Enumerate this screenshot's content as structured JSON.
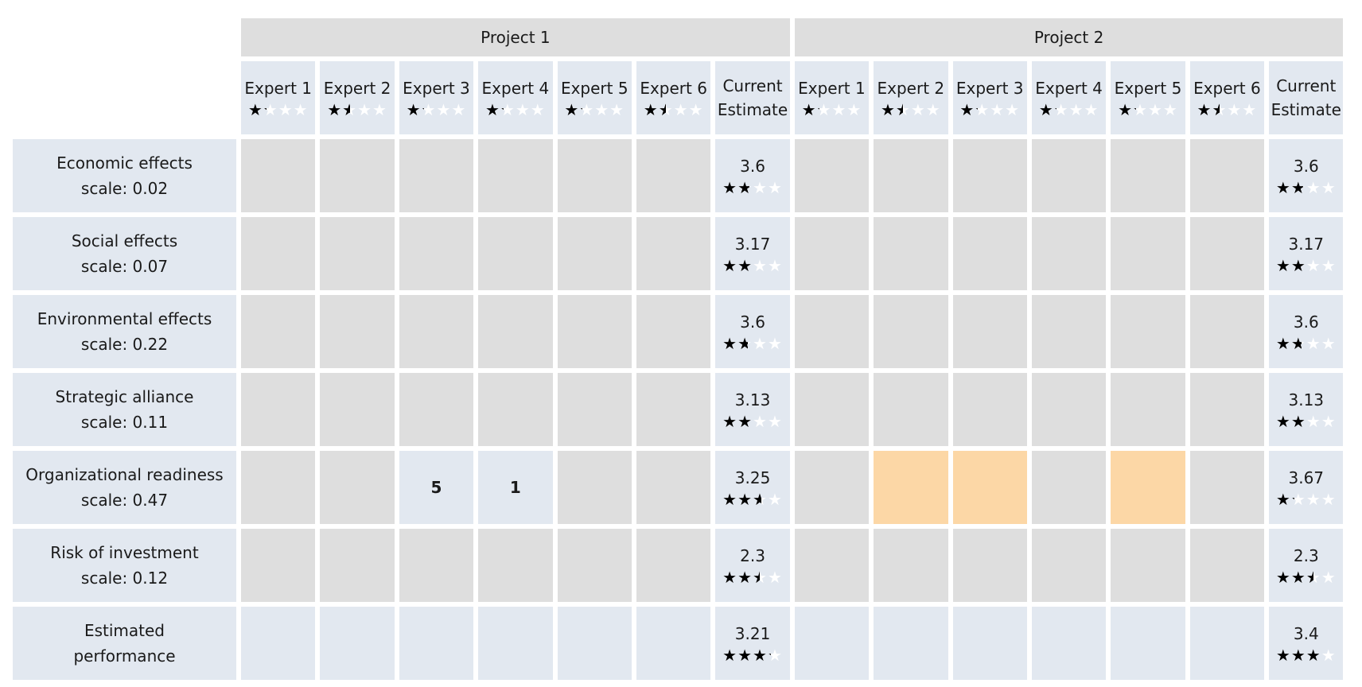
{
  "projects": [
    {
      "name": "Project 1",
      "experts": [
        {
          "label": "Expert 1",
          "rating": 1.2
        },
        {
          "label": "Expert 2",
          "rating": 1.5
        },
        {
          "label": "Expert 3",
          "rating": 1.2
        },
        {
          "label": "Expert 4",
          "rating": 1.2
        },
        {
          "label": "Expert 5",
          "rating": 1.2
        },
        {
          "label": "Expert 6",
          "rating": 1.5
        }
      ],
      "estimate_label_1": "Current",
      "estimate_label_2": "Estimate"
    },
    {
      "name": "Project 2",
      "experts": [
        {
          "label": "Expert 1",
          "rating": 1.2
        },
        {
          "label": "Expert 2",
          "rating": 1.5
        },
        {
          "label": "Expert 3",
          "rating": 1.2
        },
        {
          "label": "Expert 4",
          "rating": 1.2
        },
        {
          "label": "Expert 5",
          "rating": 1.2
        },
        {
          "label": "Expert 6",
          "rating": 1.5
        }
      ],
      "estimate_label_1": "Current",
      "estimate_label_2": "Estimate"
    }
  ],
  "max_stars": 4,
  "star_glyph": "★",
  "colors": {
    "empty": "#dedede",
    "filled": "#e2e8f0",
    "highlight": "#fcd7a6"
  },
  "rows": [
    {
      "name": "Economic effects",
      "scale": "scale: 0.02",
      "p1": {
        "cells": [
          "",
          "",
          "",
          "",
          "",
          ""
        ],
        "states": [
          "empty",
          "empty",
          "empty",
          "empty",
          "empty",
          "empty"
        ],
        "estimate": "3.6",
        "stars": 1.8
      },
      "p2": {
        "cells": [
          "",
          "",
          "",
          "",
          "",
          ""
        ],
        "states": [
          "empty",
          "empty",
          "empty",
          "empty",
          "empty",
          "empty"
        ],
        "estimate": "3.6",
        "stars": 1.8
      }
    },
    {
      "name": "Social effects",
      "scale": "scale: 0.07",
      "p1": {
        "cells": [
          "",
          "",
          "",
          "",
          "",
          ""
        ],
        "states": [
          "empty",
          "empty",
          "empty",
          "empty",
          "empty",
          "empty"
        ],
        "estimate": "3.17",
        "stars": 2.0
      },
      "p2": {
        "cells": [
          "",
          "",
          "",
          "",
          "",
          ""
        ],
        "states": [
          "empty",
          "empty",
          "empty",
          "empty",
          "empty",
          "empty"
        ],
        "estimate": "3.17",
        "stars": 2.0
      }
    },
    {
      "name": "Environmental effects",
      "scale": "scale: 0.22",
      "p1": {
        "cells": [
          "",
          "",
          "",
          "",
          "",
          ""
        ],
        "states": [
          "empty",
          "empty",
          "empty",
          "empty",
          "empty",
          "empty"
        ],
        "estimate": "3.6",
        "stars": 1.7
      },
      "p2": {
        "cells": [
          "",
          "",
          "",
          "",
          "",
          ""
        ],
        "states": [
          "empty",
          "empty",
          "empty",
          "empty",
          "empty",
          "empty"
        ],
        "estimate": "3.6",
        "stars": 1.7
      }
    },
    {
      "name": "Strategic alliance",
      "scale": "scale: 0.11",
      "p1": {
        "cells": [
          "",
          "",
          "",
          "",
          "",
          ""
        ],
        "states": [
          "empty",
          "empty",
          "empty",
          "empty",
          "empty",
          "empty"
        ],
        "estimate": "3.13",
        "stars": 2.0
      },
      "p2": {
        "cells": [
          "",
          "",
          "",
          "",
          "",
          ""
        ],
        "states": [
          "empty",
          "empty",
          "empty",
          "empty",
          "empty",
          "empty"
        ],
        "estimate": "3.13",
        "stars": 2.0
      }
    },
    {
      "name": "Organizational readiness",
      "scale": "scale: 0.47",
      "p1": {
        "cells": [
          "",
          "",
          "5",
          "1",
          "",
          ""
        ],
        "states": [
          "empty",
          "empty",
          "filled",
          "filled",
          "empty",
          "empty"
        ],
        "estimate": "3.25",
        "stars": 2.6
      },
      "p2": {
        "cells": [
          "",
          "",
          "",
          "",
          "",
          ""
        ],
        "states": [
          "empty",
          "highlight",
          "highlight",
          "empty",
          "highlight",
          "empty"
        ],
        "estimate": "3.67",
        "stars": 1.2
      }
    },
    {
      "name": "Risk of investment",
      "scale": "scale: 0.12",
      "p1": {
        "cells": [
          "",
          "",
          "",
          "",
          "",
          ""
        ],
        "states": [
          "empty",
          "empty",
          "empty",
          "empty",
          "empty",
          "empty"
        ],
        "estimate": "2.3",
        "stars": 2.5
      },
      "p2": {
        "cells": [
          "",
          "",
          "",
          "",
          "",
          ""
        ],
        "states": [
          "empty",
          "empty",
          "empty",
          "empty",
          "empty",
          "empty"
        ],
        "estimate": "2.3",
        "stars": 2.5
      }
    },
    {
      "name": "Estimated",
      "scale": "performance",
      "p1": {
        "cells": [
          "",
          "",
          "",
          "",
          "",
          ""
        ],
        "states": [
          "filled",
          "filled",
          "filled",
          "filled",
          "filled",
          "filled"
        ],
        "estimate": "3.21",
        "stars": 3.2
      },
      "p2": {
        "cells": [
          "",
          "",
          "",
          "",
          "",
          ""
        ],
        "states": [
          "filled",
          "filled",
          "filled",
          "filled",
          "filled",
          "filled"
        ],
        "estimate": "3.4",
        "stars": 3.0
      }
    }
  ]
}
